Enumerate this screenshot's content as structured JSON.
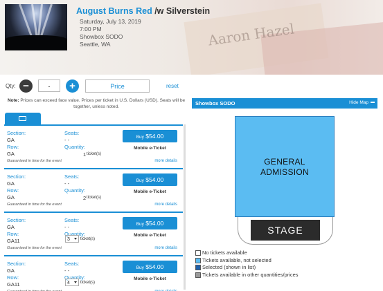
{
  "event": {
    "headliner": "August Burns Red",
    "with": " /w Silverstein",
    "date": "Saturday, July 13, 2019",
    "time": "7:00 PM",
    "venue": "Showbox SODO",
    "city": "Seattle, WA",
    "banner_text": "Aaron Hazel"
  },
  "filters": {
    "qty_label": "Qty:",
    "qty_value": "-",
    "price_label": "Price",
    "reset_label": "reset"
  },
  "note": {
    "bold": "Note:",
    "text": " Prices can exceed face value. Prices per ticket in U.S. Dollars (USD). Seats will be together, unless noted."
  },
  "listing_labels": {
    "section": "Section:",
    "row": "Row:",
    "seats": "Seats:",
    "quantity": "Quantity:",
    "tickets_suffix": "ticket(s)",
    "guarantee": "Guaranteed in time for the event",
    "more": "more details",
    "buy_prefix": "Buy"
  },
  "listings": [
    {
      "section": "GA",
      "row": "GA",
      "seats": "- -",
      "quantity": "1",
      "qty_is_select": false,
      "price": "$54.00",
      "delivery": "Mobile e-Ticket"
    },
    {
      "section": "GA",
      "row": "GA",
      "seats": "- -",
      "quantity": "2",
      "qty_is_select": false,
      "price": "$54.00",
      "delivery": "Mobile e-Ticket"
    },
    {
      "section": "GA",
      "row": "GA11",
      "seats": "- -",
      "quantity": "3",
      "qty_is_select": true,
      "price": "$54.00",
      "delivery": "Mobile e-Ticket"
    },
    {
      "section": "GA",
      "row": "GA11",
      "seats": "- -",
      "quantity": "4",
      "qty_is_select": true,
      "price": "$54.00",
      "delivery": "Mobile e-Ticket"
    }
  ],
  "map": {
    "title": "Showbox SODO",
    "hide_label": "Hide Map",
    "ga_line1": "GENERAL",
    "ga_line2": "ADMISSION",
    "stage": "STAGE",
    "ga_color": "#5bbcf2"
  },
  "legend": [
    {
      "label": "No tickets available",
      "color": "#ffffff"
    },
    {
      "label": "Tickets available, not selected",
      "color": "#5bbcf2"
    },
    {
      "label": "Selected (shown in list)",
      "color": "#1f5fa8"
    },
    {
      "label": "Tickets available in other quantities/prices",
      "color": "#999999"
    }
  ],
  "colors": {
    "accent": "#1a8fd5"
  }
}
